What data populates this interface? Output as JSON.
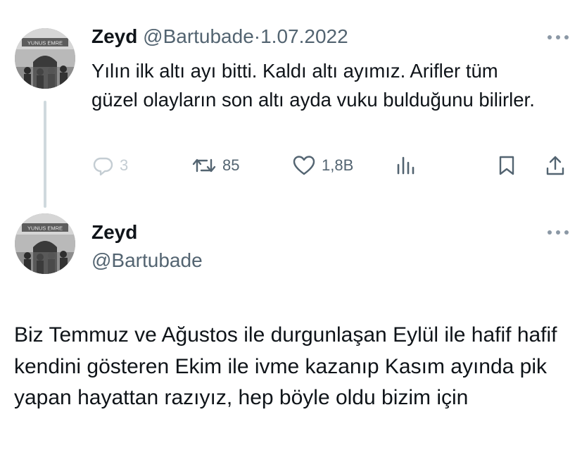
{
  "tweet1": {
    "author_name": "Zeyd",
    "handle": "@Bartubade",
    "separator": "·",
    "date": "1.07.2022",
    "text": "Yılın ilk altı ayı bitti. Kaldı altı ayımız. Arifler tüm güzel olayların son altı ayda vuku bulduğunu bilirler.",
    "avatar_sign_text": "YUNUS EMRE",
    "actions": {
      "replies": "3",
      "retweets": "85",
      "likes": "1,8B"
    }
  },
  "tweet2": {
    "author_name": "Zeyd",
    "handle": "@Bartubade",
    "avatar_sign_text": "YUNUS EMRE",
    "text": "Biz Temmuz ve Ağustos ile durgunlaşan Eylül ile hafif hafif kendini gösteren Ekim ile ivme kazanıp Kasım ayında pik yapan hayattan razıyız, hep böyle oldu bizim için"
  },
  "icons": {
    "reply": "reply-icon",
    "retweet": "retweet-icon",
    "like": "heart-icon",
    "views": "views-icon",
    "bookmark": "bookmark-icon",
    "share": "share-icon",
    "more": "more-icon"
  },
  "colors": {
    "text": "#0f1419",
    "secondary": "#536471",
    "faded": "#c4cdd3",
    "thread_line": "#cfd9de"
  }
}
